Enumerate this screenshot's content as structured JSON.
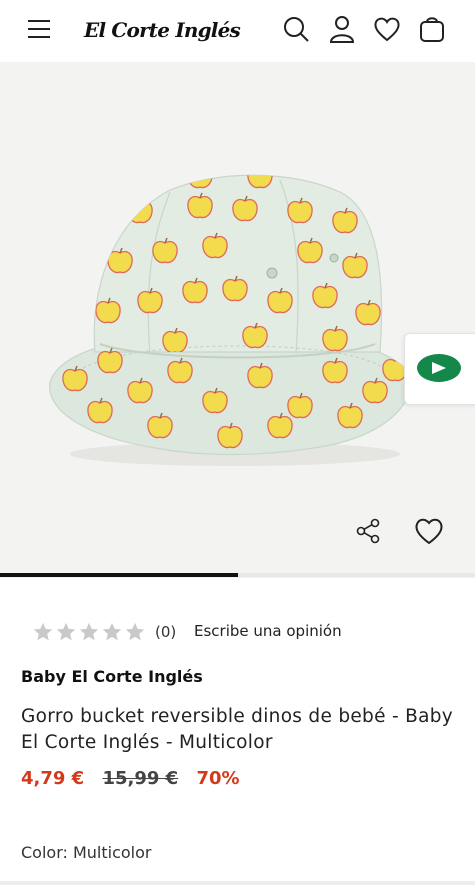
{
  "header": {
    "logo": "El Corte Inglés",
    "icons": [
      "menu-icon",
      "search-icon",
      "user-icon",
      "heart-icon",
      "bag-icon"
    ]
  },
  "gallery": {
    "carousel_progress": 0.5
  },
  "product": {
    "rating": {
      "stars": 0,
      "max_stars": 5,
      "count_label": "(0)",
      "write_review": "Escribe una opinión"
    },
    "brand": "Baby El Corte Inglés",
    "title": "Gorro bucket reversible dinos de bebé - Baby El Corte Inglés - Multicolor",
    "price_now": "4,79 €",
    "price_old": "15,99 €",
    "discount": "70%",
    "color": "Color: Multicolor"
  },
  "colors": {
    "sale_red": "#d33a1c",
    "hat_mint": "#dfe9df",
    "apple_yellow": "#f2dc4e",
    "apple_outline": "#e0695a",
    "vendor_green": "#13884a"
  }
}
